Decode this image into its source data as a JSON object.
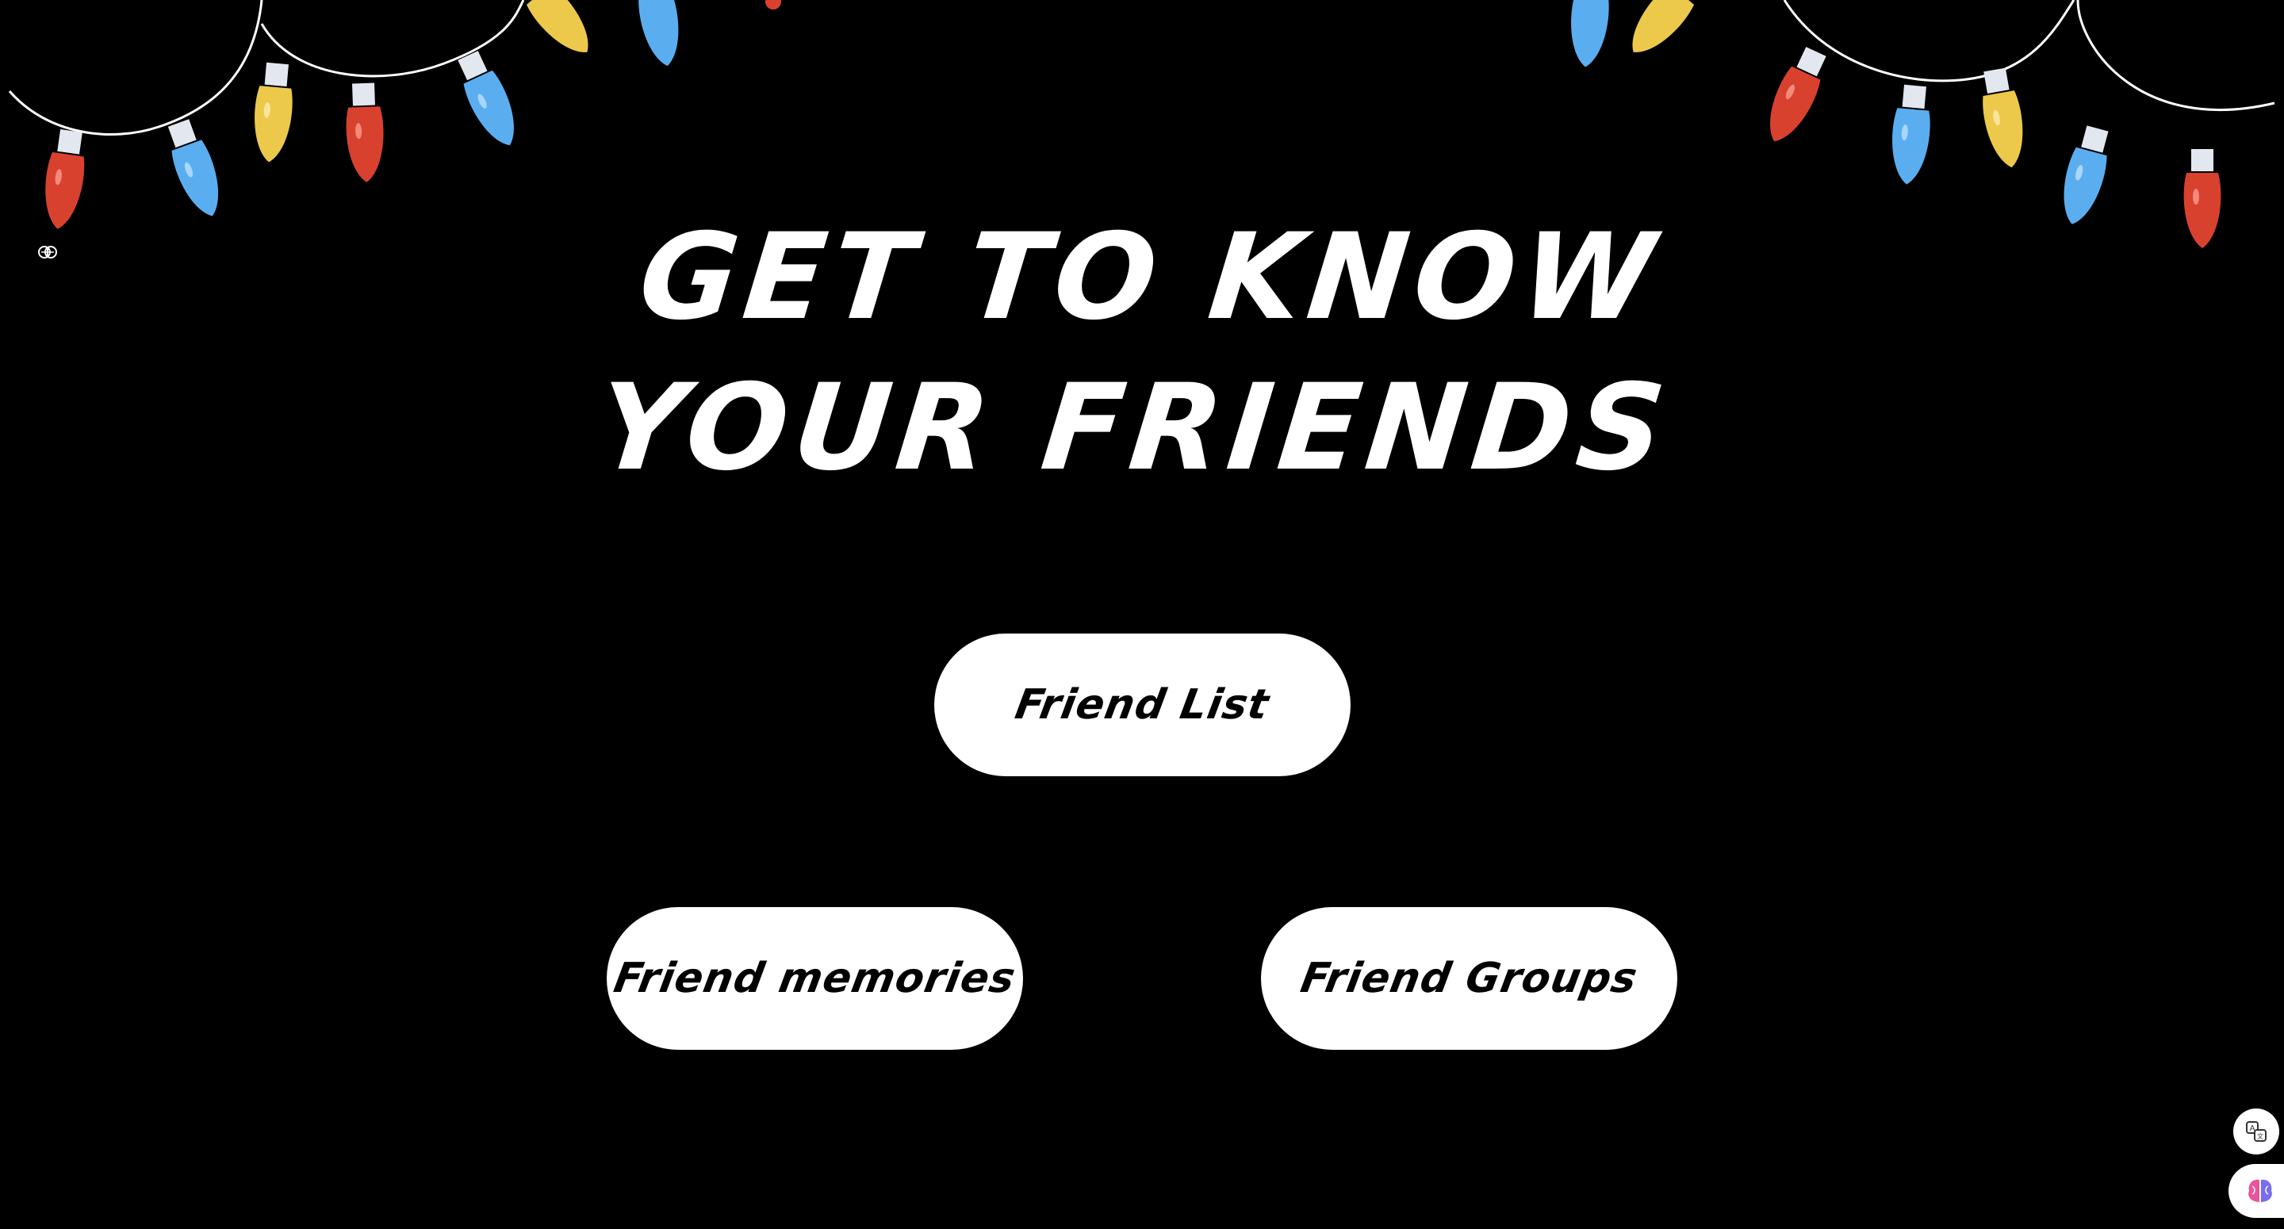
{
  "hero": {
    "title_line1": "GET TO KNOW",
    "title_line2": "YOUR FRIENDS"
  },
  "buttons": {
    "friend_list": "Friend List",
    "friend_memories": "Friend memories",
    "friend_groups": "Friend Groups"
  },
  "icons": {
    "top_left": "brain-icon",
    "translate": "translate-icon",
    "assistant": "brain-icon"
  },
  "colors": {
    "background": "#000000",
    "text": "#ffffff",
    "button_bg": "#ffffff",
    "button_text": "#000000",
    "bulb_red": "#d9412f",
    "bulb_blue": "#5aaef0",
    "bulb_yellow": "#ecc94b"
  }
}
